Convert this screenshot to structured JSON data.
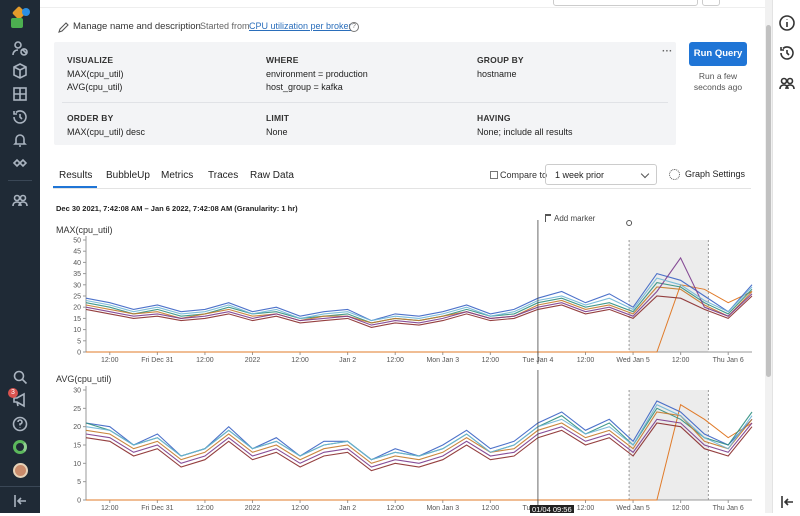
{
  "header": {
    "manage_label": "Manage name and description",
    "started_from_prefix": "Started from",
    "started_from_link": "CPU utilization per broker"
  },
  "query": {
    "visualize_label": "VISUALIZE",
    "visualize": [
      "MAX(cpu_util)",
      "AVG(cpu_util)"
    ],
    "where_label": "WHERE",
    "where": [
      "environment = production",
      "host_group = kafka"
    ],
    "group_by_label": "GROUP BY",
    "group_by": "hostname",
    "order_by_label": "ORDER BY",
    "order_by": "MAX(cpu_util) desc",
    "limit_label": "LIMIT",
    "limit": "None",
    "having_label": "HAVING",
    "having": "None; include all results",
    "more_label": "···",
    "run_label": "Run Query",
    "run_status": "Run a few seconds ago"
  },
  "tabs": [
    "Results",
    "BubbleUp",
    "Metrics",
    "Traces",
    "Raw Data"
  ],
  "compare": {
    "label": "Compare to",
    "value": "1 week prior"
  },
  "graph_settings_label": "Graph Settings",
  "time_range": "Dec 30 2021, 7:42:08 AM – Jan 6 2022, 7:42:08 AM (Granularity: 1 hr)",
  "add_marker_label": "Add marker",
  "cursor_label": "01/04 09:56",
  "notification_count": "3",
  "colors": {
    "accent": "#1f75d6",
    "nav_bg": "#1f2a36",
    "series": [
      "#3a63c4",
      "#2f8f7f",
      "#c47a2a",
      "#7a3a8c",
      "#6fb6d6",
      "#8a2b2b",
      "#2a3f9a",
      "#e07b2a"
    ]
  },
  "chart_data": [
    {
      "type": "line",
      "title": "MAX(cpu_util)",
      "ylim": [
        0,
        50
      ],
      "yticks": [
        0,
        5,
        10,
        15,
        20,
        25,
        30,
        35,
        40,
        45,
        50
      ],
      "xlabels": [
        "12:00",
        "Fri Dec 31",
        "12:00",
        "2022",
        "12:00",
        "Jan 2",
        "12:00",
        "Mon Jan 3",
        "12:00",
        "Tue Jan 4",
        "12:00",
        "Wed Jan 5",
        "12:00",
        "Thu Jan 6"
      ],
      "x": [
        0,
        6,
        12,
        18,
        24,
        30,
        36,
        42,
        48,
        54,
        60,
        66,
        72,
        78,
        84,
        90,
        96,
        102,
        108,
        114,
        120,
        126,
        132,
        138,
        144,
        150,
        156,
        162,
        168
      ],
      "series": [
        {
          "values": [
            24,
            22,
            19,
            21,
            18,
            19,
            22,
            18,
            20,
            16,
            18,
            19,
            14,
            17,
            16,
            18,
            21,
            17,
            19,
            24,
            27,
            22,
            26,
            20,
            35,
            32,
            25,
            18,
            30
          ]
        },
        {
          "values": [
            22,
            20,
            17,
            19,
            16,
            17,
            20,
            17,
            18,
            15,
            16,
            17,
            13,
            15,
            14,
            16,
            19,
            16,
            17,
            22,
            24,
            20,
            22,
            18,
            31,
            29,
            22,
            17,
            28
          ]
        },
        {
          "values": [
            21,
            19,
            17,
            18,
            15,
            17,
            19,
            16,
            17,
            14,
            16,
            16,
            13,
            15,
            14,
            16,
            18,
            15,
            16,
            21,
            23,
            19,
            21,
            17,
            29,
            28,
            21,
            16,
            27
          ]
        },
        {
          "values": [
            20,
            18,
            16,
            17,
            15,
            16,
            18,
            15,
            17,
            14,
            15,
            16,
            12,
            14,
            13,
            15,
            18,
            15,
            16,
            20,
            22,
            18,
            20,
            16,
            27,
            42,
            20,
            16,
            26
          ]
        },
        {
          "values": [
            23,
            21,
            18,
            20,
            17,
            18,
            21,
            17,
            19,
            15,
            17,
            18,
            14,
            16,
            15,
            17,
            20,
            16,
            18,
            23,
            25,
            21,
            24,
            19,
            33,
            30,
            23,
            18,
            29
          ]
        },
        {
          "values": [
            19,
            17,
            15,
            16,
            14,
            15,
            17,
            14,
            16,
            13,
            14,
            15,
            11,
            13,
            12,
            14,
            17,
            14,
            15,
            19,
            21,
            17,
            19,
            15,
            25,
            24,
            19,
            15,
            25
          ]
        }
      ],
      "flat_series": {
        "values": [
          0,
          0,
          0,
          0,
          0,
          0,
          0,
          0,
          0,
          0,
          0,
          0,
          0,
          0,
          0,
          0,
          0,
          0,
          0,
          0,
          0,
          0,
          0,
          0,
          0,
          30,
          28,
          22,
          27
        ]
      }
    },
    {
      "type": "line",
      "title": "AVG(cpu_util)",
      "ylim": [
        0,
        30
      ],
      "yticks": [
        0,
        5,
        10,
        15,
        20,
        25,
        30
      ],
      "xlabels": [
        "12:00",
        "Fri Dec 31",
        "12:00",
        "2022",
        "12:00",
        "Jan 2",
        "12:00",
        "Mon Jan 3",
        "12:00",
        "Tue Jan 4",
        "12:00",
        "Wed Jan 5",
        "12:00",
        "Thu Jan 6"
      ],
      "x": [
        0,
        6,
        12,
        18,
        24,
        30,
        36,
        42,
        48,
        54,
        60,
        66,
        72,
        78,
        84,
        90,
        96,
        102,
        108,
        114,
        120,
        126,
        132,
        138,
        144,
        150,
        156,
        162,
        168
      ],
      "series": [
        {
          "values": [
            21,
            20,
            15,
            18,
            12,
            14,
            20,
            14,
            17,
            12,
            16,
            16,
            11,
            14,
            12,
            15,
            19,
            14,
            16,
            21,
            24,
            19,
            22,
            16,
            27,
            24,
            18,
            15,
            22
          ]
        },
        {
          "values": [
            21,
            19,
            15,
            17,
            12,
            14,
            19,
            14,
            16,
            12,
            15,
            16,
            11,
            13,
            12,
            14,
            18,
            13,
            15,
            20,
            23,
            18,
            21,
            15,
            25,
            22,
            17,
            15,
            24
          ]
        },
        {
          "values": [
            19,
            18,
            14,
            16,
            11,
            13,
            18,
            13,
            15,
            11,
            14,
            15,
            10,
            12,
            11,
            13,
            17,
            13,
            14,
            19,
            21,
            17,
            19,
            14,
            24,
            23,
            16,
            14,
            22
          ]
        },
        {
          "values": [
            18,
            17,
            13,
            15,
            10,
            12,
            17,
            12,
            14,
            10,
            13,
            14,
            9,
            11,
            10,
            12,
            16,
            12,
            13,
            18,
            20,
            16,
            18,
            13,
            22,
            21,
            15,
            13,
            21
          ]
        },
        {
          "values": [
            20,
            19,
            15,
            17,
            12,
            14,
            19,
            14,
            16,
            12,
            15,
            16,
            11,
            13,
            12,
            14,
            18,
            13,
            15,
            20,
            22,
            18,
            20,
            15,
            26,
            23,
            17,
            14,
            23
          ]
        },
        {
          "values": [
            17,
            16,
            12,
            14,
            9,
            11,
            16,
            11,
            13,
            9,
            12,
            13,
            8,
            10,
            9,
            11,
            15,
            11,
            12,
            17,
            19,
            15,
            17,
            12,
            21,
            20,
            14,
            12,
            20
          ]
        }
      ],
      "flat_series": {
        "values": [
          0,
          0,
          0,
          0,
          0,
          0,
          0,
          0,
          0,
          0,
          0,
          0,
          0,
          0,
          0,
          0,
          0,
          0,
          0,
          0,
          0,
          0,
          0,
          0,
          0,
          26,
          22,
          17,
          21
        ]
      }
    }
  ]
}
